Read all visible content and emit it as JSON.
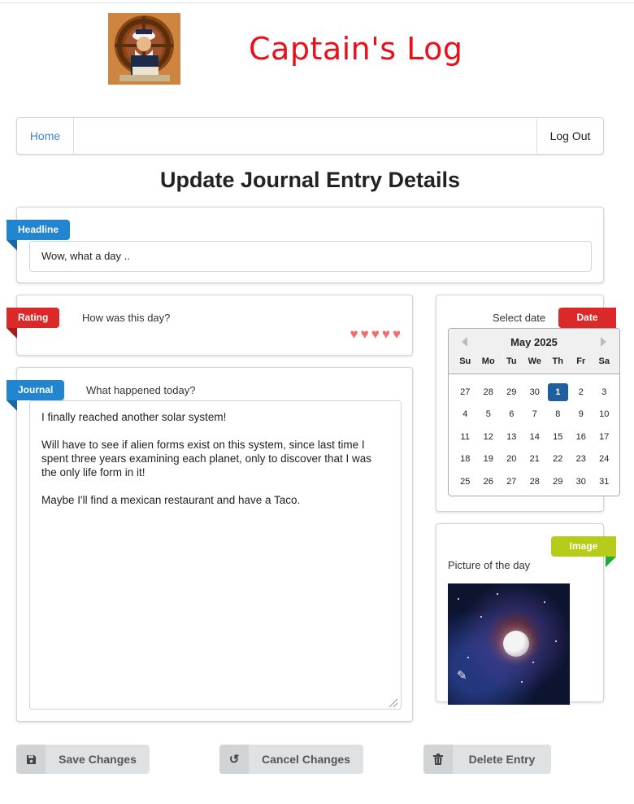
{
  "site": {
    "title": "Captain's Log",
    "logo_icon": "captain-reading-icon"
  },
  "nav": {
    "home": "Home",
    "logout": "Log Out"
  },
  "page": {
    "title": "Update Journal Entry Details"
  },
  "headline": {
    "ribbon": "Headline",
    "value": "Wow, what a day .."
  },
  "rating": {
    "ribbon": "Rating",
    "prompt": "How was this day?",
    "hearts": 5,
    "max_hearts": 5,
    "heart_color": "#f26d6d"
  },
  "journal": {
    "ribbon": "Journal",
    "prompt": "What happened today?",
    "text": "I finally reached another solar system!\n\nWill have to see if alien forms exist on this system, since last time I spent three years examining each planet, only to discover that I was the only life form in it!\n\nMaybe I'll find a mexican restaurant and have a Taco."
  },
  "date": {
    "ribbon": "Date",
    "label": "Select date",
    "calendar": {
      "month": "May 2025",
      "weekdays": [
        "Su",
        "Mo",
        "Tu",
        "We",
        "Th",
        "Fr",
        "Sa"
      ],
      "days": [
        "27",
        "28",
        "29",
        "30",
        "1",
        "2",
        "3",
        "4",
        "5",
        "6",
        "7",
        "8",
        "9",
        "10",
        "11",
        "12",
        "13",
        "14",
        "15",
        "16",
        "17",
        "18",
        "19",
        "20",
        "21",
        "22",
        "23",
        "24",
        "25",
        "26",
        "27",
        "28",
        "29",
        "30",
        "31"
      ],
      "selected": "1"
    }
  },
  "image": {
    "ribbon": "Image",
    "label": "Picture of the day",
    "edit_icon": "pencil-icon"
  },
  "actions": {
    "save": {
      "label": "Save Changes",
      "icon": "floppy-disk-icon"
    },
    "cancel": {
      "label": "Cancel Changes",
      "icon": "undo-icon"
    },
    "delete": {
      "label": "Delete Entry",
      "icon": "trash-icon"
    }
  },
  "colors": {
    "title_red": "#e8101a",
    "ribbon_blue": "#2185d0",
    "ribbon_red": "#db2828",
    "ribbon_lime": "#b5cc18",
    "selected_day": "#1f5fa0",
    "link": "#4183c4"
  }
}
